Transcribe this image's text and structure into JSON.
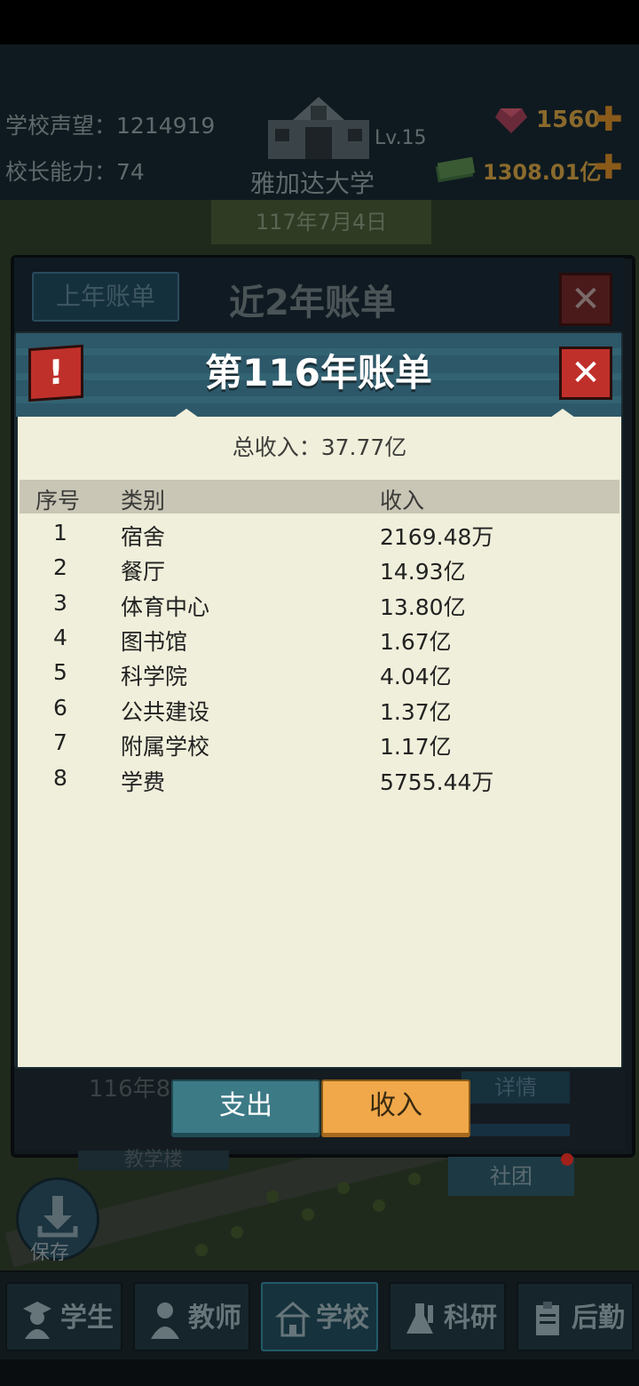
{
  "header": {
    "reputation_label": "学校声望：1214919",
    "principal_label": "校长能力：74",
    "level": "Lv.15",
    "school_name": "雅加达大学",
    "date": "117年7月4日",
    "gems": "1560",
    "money": "1308.01亿",
    "colors": {
      "gem": "#d23a5a",
      "money": "#3a9a3a",
      "currency_text": "#f0a030"
    }
  },
  "outer_dialog": {
    "prev_year_label": "上年账单",
    "title": "近2年账单",
    "dim_row_text": "116年8",
    "dim_detail_label": "详情"
  },
  "inner_dialog": {
    "title": "第116年账单",
    "total_income": "总收入：37.77亿",
    "columns": [
      "序号",
      "类别",
      "收入"
    ],
    "rows": [
      {
        "no": "1",
        "category": "宿舍",
        "income": "2169.48万"
      },
      {
        "no": "2",
        "category": "餐厅",
        "income": "14.93亿"
      },
      {
        "no": "3",
        "category": "体育中心",
        "income": "13.80亿"
      },
      {
        "no": "4",
        "category": "图书馆",
        "income": "1.67亿"
      },
      {
        "no": "5",
        "category": "科学院",
        "income": "4.04亿"
      },
      {
        "no": "6",
        "category": "公共建设",
        "income": "1.37亿"
      },
      {
        "no": "7",
        "category": "附属学校",
        "income": "1.17亿"
      },
      {
        "no": "8",
        "category": "学费",
        "income": "5755.44万"
      }
    ],
    "colors": {
      "header": "#2c5869",
      "body": "#f0efdb",
      "close": "#c0302a"
    }
  },
  "tabs": {
    "expense": "支出",
    "income": "收入",
    "active": "income"
  },
  "map_labels": {
    "teaching_building": "教学楼",
    "club": "社团",
    "save": "保存"
  },
  "bottom_nav": [
    {
      "label": "学生",
      "icon": "student-icon"
    },
    {
      "label": "教师",
      "icon": "teacher-icon"
    },
    {
      "label": "学校",
      "icon": "school-icon",
      "active": true
    },
    {
      "label": "科研",
      "icon": "research-icon"
    },
    {
      "label": "后勤",
      "icon": "logistics-icon"
    }
  ]
}
